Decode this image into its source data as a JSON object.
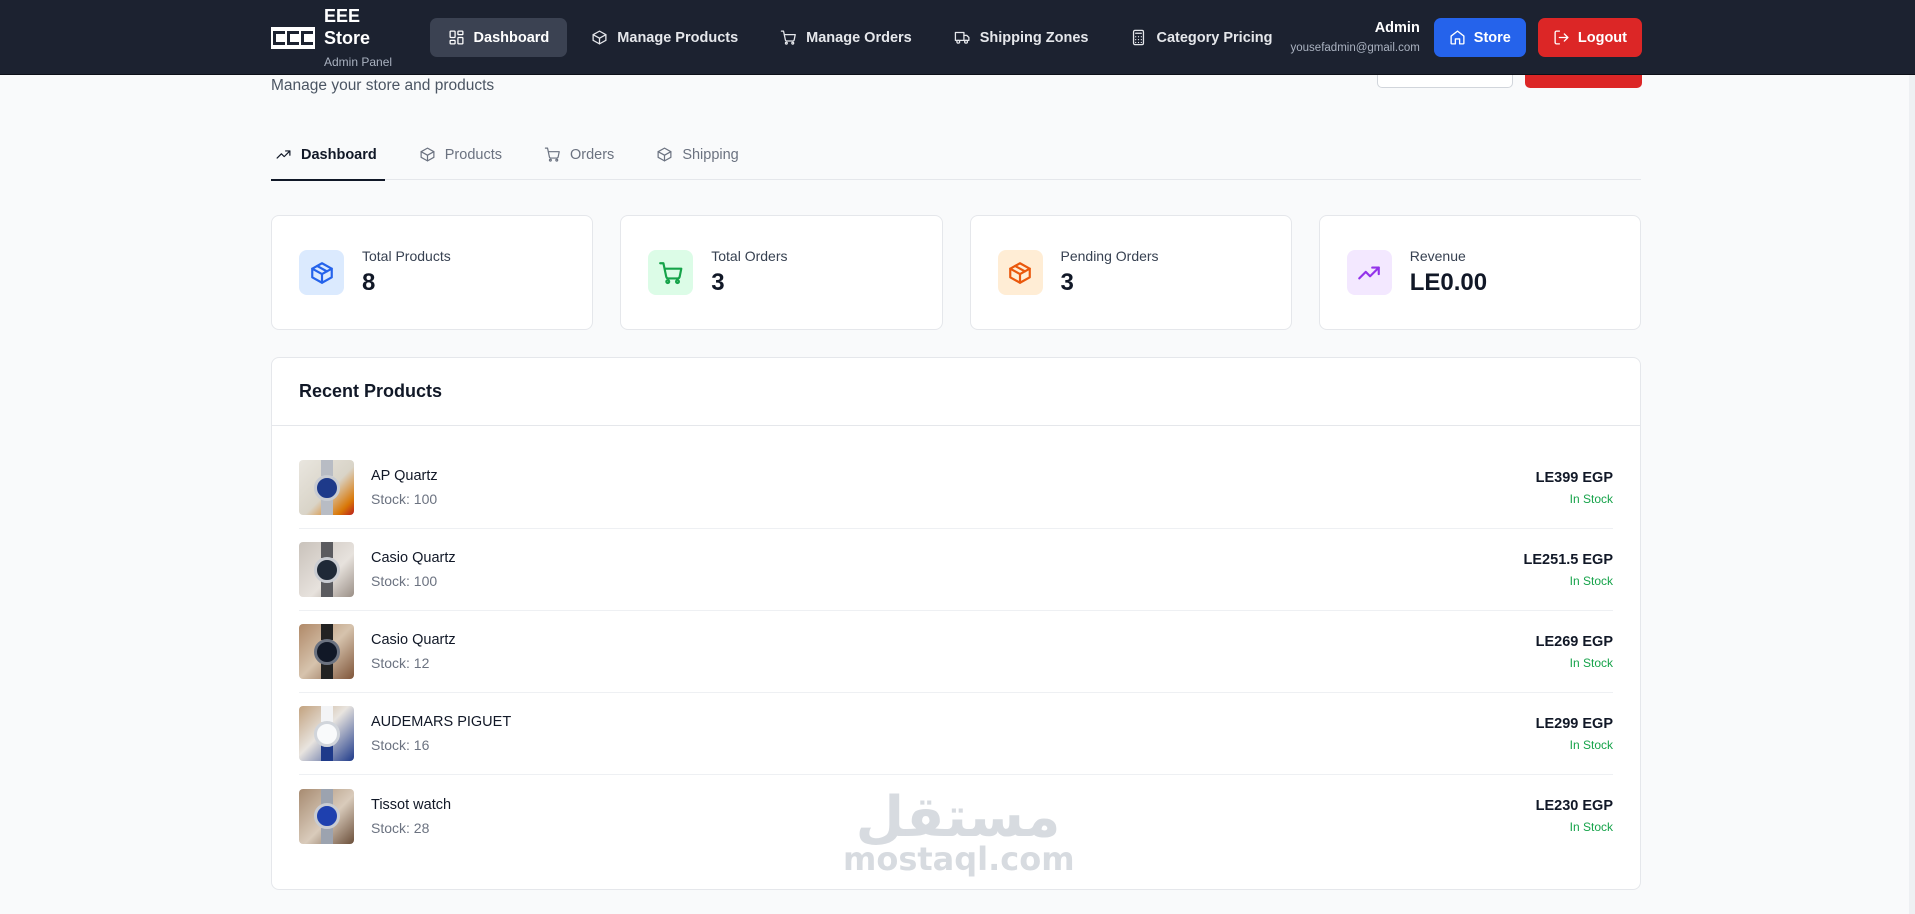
{
  "colors": {
    "navbar_bg": "#1c2230",
    "store_button": "#2563eb",
    "logout_button": "#dc2626",
    "in_stock": "#16a34a"
  },
  "brand": {
    "title": "EEE Store",
    "subtitle": "Admin Panel"
  },
  "nav": {
    "items": [
      {
        "label": "Dashboard",
        "icon": "grid-icon",
        "active": true
      },
      {
        "label": "Manage Products",
        "icon": "package-icon"
      },
      {
        "label": "Manage Orders",
        "icon": "cart-icon"
      },
      {
        "label": "Shipping Zones",
        "icon": "truck-icon"
      },
      {
        "label": "Category Pricing",
        "icon": "calculator-icon"
      }
    ]
  },
  "user": {
    "name": "Admin",
    "email": "yousefadmin@gmail.com"
  },
  "buttons": {
    "store": "Store",
    "logout": "Logout"
  },
  "page": {
    "subtitle": "Manage your store and products"
  },
  "tabs": [
    {
      "label": "Dashboard",
      "icon": "trending-up-icon",
      "active": true
    },
    {
      "label": "Products",
      "icon": "package-icon"
    },
    {
      "label": "Orders",
      "icon": "cart-icon"
    },
    {
      "label": "Shipping",
      "icon": "package-icon"
    }
  ],
  "stats": [
    {
      "label": "Total Products",
      "value": "8",
      "icon": "package-icon",
      "color": "#2563eb",
      "bg": "#dbeafe"
    },
    {
      "label": "Total Orders",
      "value": "3",
      "icon": "cart-icon",
      "color": "#16a34a",
      "bg": "#dcfce7"
    },
    {
      "label": "Pending Orders",
      "value": "3",
      "icon": "package-icon",
      "color": "#ea580c",
      "bg": "#ffedd5"
    },
    {
      "label": "Revenue",
      "value": "LE0.00",
      "icon": "trending-up-icon",
      "color": "#9333ea",
      "bg": "#f3e8ff"
    }
  ],
  "recent_products": {
    "title": "Recent Products",
    "items": [
      {
        "name": "AP Quartz",
        "stock": "Stock: 100",
        "price": "LE399 EGP",
        "status": "In Stock"
      },
      {
        "name": "Casio Quartz",
        "stock": "Stock: 100",
        "price": "LE251.5 EGP",
        "status": "In Stock"
      },
      {
        "name": "Casio Quartz",
        "stock": "Stock: 12",
        "price": "LE269 EGP",
        "status": "In Stock"
      },
      {
        "name": "AUDEMARS PIGUET",
        "stock": "Stock: 16",
        "price": "LE299 EGP",
        "status": "In Stock"
      },
      {
        "name": "Tissot watch",
        "stock": "Stock: 28",
        "price": "LE230 EGP",
        "status": "In Stock"
      }
    ]
  },
  "watermark": {
    "arabic": "مستقل",
    "latin": "mostaql.com"
  }
}
